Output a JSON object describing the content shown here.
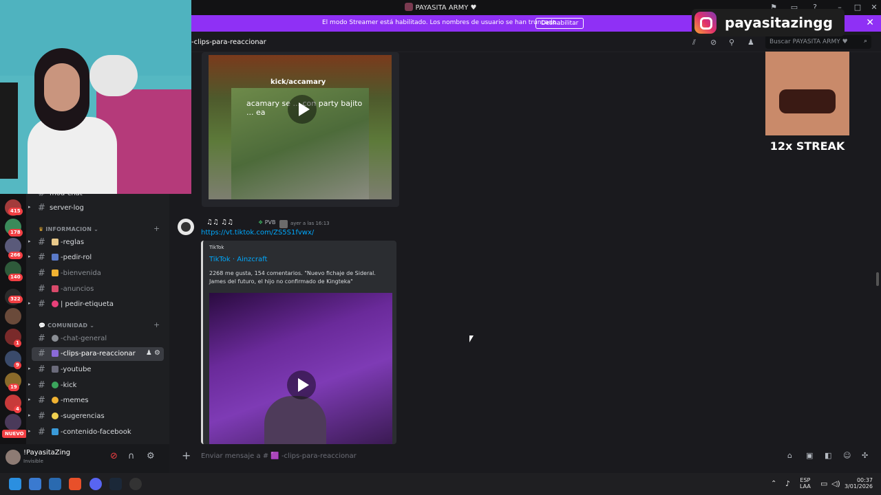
{
  "window": {
    "title": "PAYASITA ARMY ♥"
  },
  "banner": {
    "message": "El modo Streamer está habilitado. Los nombres de usuario se han truncado.",
    "button": "Deshabilitar"
  },
  "channel_header": {
    "name": "-clips-para-reaccionar",
    "search_placeholder": "Buscar PAYASITA ARMY ♥"
  },
  "servers": {
    "badges": [
      "415",
      "178",
      "266",
      "140",
      "322",
      "1",
      "9",
      "19",
      "4"
    ],
    "nuevo": "NUEVO"
  },
  "channels": {
    "partial_top": "mod-chat",
    "server_log": "server-log",
    "cat_info": "INFORMACION",
    "reglas": "-reglas",
    "pedir_rol": "-pedir-rol",
    "bienvenida": "-bienvenida",
    "anuncios": "-anuncios",
    "pedir_etiqueta": "| pedir-etiqueta",
    "cat_comunidad": "COMUNIDAD",
    "chat_general": "-chat-general",
    "clips": "-clips-para-reaccionar",
    "youtube": "-youtube",
    "kick": "-kick",
    "memes": "-memes",
    "sugerencias": "-sugerencias",
    "contenido_facebook": "-contenido-facebook"
  },
  "user": {
    "name": "!PayasitaZing",
    "status": "Invisible"
  },
  "video1": {
    "overlay_user": "kick/accamary",
    "overlay_text": "acamary se ... con party bajito ... ea"
  },
  "message": {
    "author": "♫♫ ♫♫",
    "role": "PVB",
    "timestamp": "ayer a las 16:13",
    "link": "https://vt.tiktok.com/ZS5S1fvwx/",
    "embed_provider": "TikTok",
    "embed_title": "TikTok · Ainzcraft",
    "embed_description": "2268 me gusta, 154 comentarios. \"Nuevo fichaje de Sideral. James del futuro, el hijo no confirmado de Kingteka\""
  },
  "composer": {
    "placeholder": "Enviar mensaje a # 🟪 -clips-para-reaccionar"
  },
  "taskbar": {
    "lang_top": "ESP",
    "lang_bottom": "LAA",
    "time": "00:37",
    "date": "3/01/2026"
  },
  "overlays": {
    "instagram_handle": "payasitazingg",
    "streak": "12x STREAK"
  },
  "colors": {
    "banner": "#8f30f5",
    "link": "#00a8fc",
    "badge": "#f23f43",
    "active_channel": "#3a3c42"
  }
}
